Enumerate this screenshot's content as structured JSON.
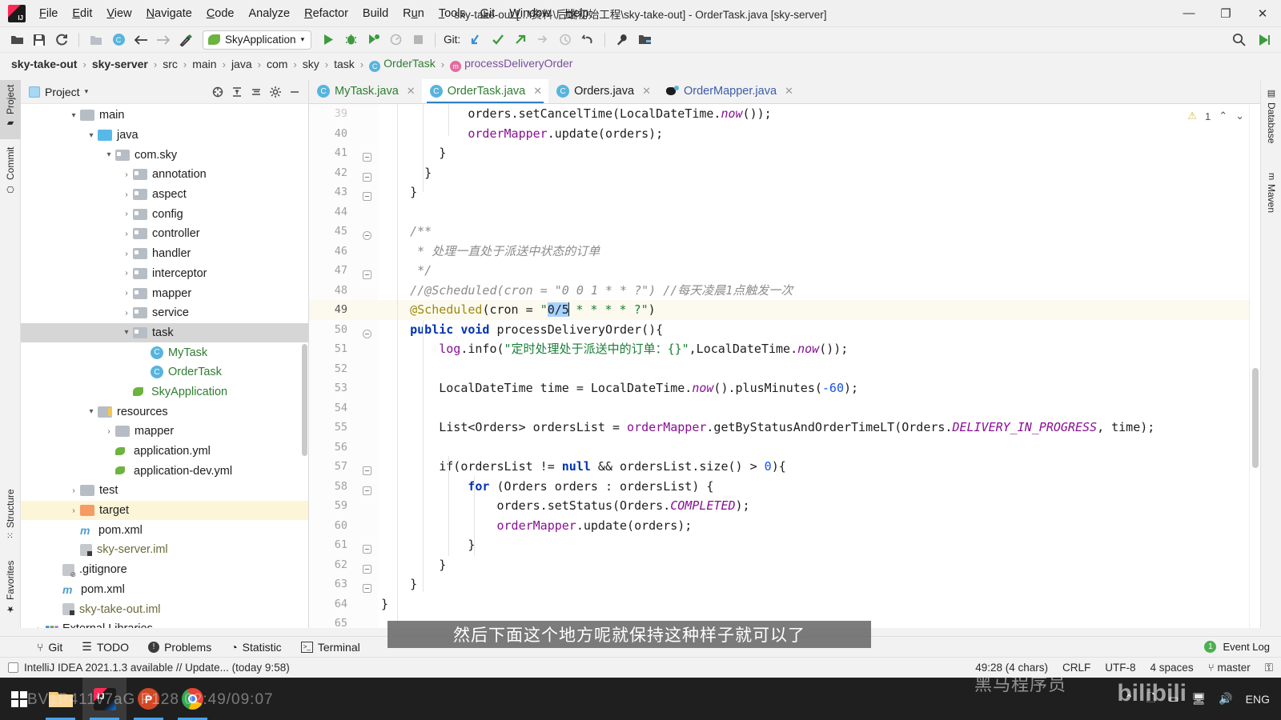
{
  "window": {
    "title": "sky-take-out [...\\资料\\后端初始工程\\sky-take-out] - OrderTask.java [sky-server]",
    "minimize": "—",
    "maximize": "❐",
    "close": "✕"
  },
  "menu": [
    {
      "label": "File"
    },
    {
      "label": "Edit"
    },
    {
      "label": "View"
    },
    {
      "label": "Navigate"
    },
    {
      "label": "Code"
    },
    {
      "label": "Analyze"
    },
    {
      "label": "Refactor"
    },
    {
      "label": "Build"
    },
    {
      "label": "Run"
    },
    {
      "label": "Tools"
    },
    {
      "label": "Git"
    },
    {
      "label": "Window"
    },
    {
      "label": "Help"
    }
  ],
  "toolbar": {
    "open_icon": "open-folder-icon",
    "save_icon": "save-icon",
    "sync_icon": "refresh-icon",
    "module_icon": "module-icon",
    "class_icon": "class-icon",
    "back_icon": "back-arrow-icon",
    "forward_icon": "forward-arrow-icon",
    "build_icon": "hammer-icon",
    "run_config": "SkyApplication",
    "run_icon": "run-icon",
    "debug_icon": "debug-icon",
    "run_coverage_icon": "run-with-coverage-icon",
    "profile_icon": "profiler-icon",
    "stop_icon": "stop-icon",
    "git_label": "Git:",
    "search_icon": "search-icon",
    "update_icon": "update-project-icon",
    "commit_icon": "commit-icon",
    "push_icon": "push-icon",
    "rollback_icon": "rollback-icon",
    "history_icon": "history-icon",
    "undo_icon": "undo-icon",
    "settings_icon": "wrench-icon",
    "project_structure_icon": "project-structure-icon"
  },
  "breadcrumb": [
    {
      "label": "sky-take-out",
      "style": "bold"
    },
    {
      "label": "sky-server",
      "style": "bold"
    },
    {
      "label": "src",
      "style": "plain"
    },
    {
      "label": "main",
      "style": "plain"
    },
    {
      "label": "java",
      "style": "plain"
    },
    {
      "label": "com",
      "style": "plain"
    },
    {
      "label": "sky",
      "style": "plain"
    },
    {
      "label": "task",
      "style": "plain"
    },
    {
      "label": "OrderTask",
      "style": "class",
      "badge": "C"
    },
    {
      "label": "processDeliveryOrder",
      "style": "method",
      "badge": "m"
    }
  ],
  "left_rail": [
    {
      "label": "Project",
      "icon": "project-icon",
      "active": true
    },
    {
      "label": "Commit",
      "icon": "commit-icon",
      "active": false
    },
    {
      "label": "Structure",
      "icon": "structure-icon",
      "active": false
    },
    {
      "label": "Favorites",
      "icon": "star-icon",
      "active": false
    }
  ],
  "right_rail": [
    {
      "label": "Database",
      "icon": "database-icon"
    },
    {
      "label": "Maven",
      "icon": "maven-icon"
    }
  ],
  "project_panel": {
    "title": "Project",
    "caret": "▾",
    "actions": [
      "target-icon",
      "collapse-all-icon",
      "expand-selection-icon",
      "gear-icon",
      "hide-icon"
    ],
    "tree": [
      {
        "depth": 2,
        "arrow": "▾",
        "icon": "folder-grey",
        "label": "main",
        "style": "plain"
      },
      {
        "depth": 3,
        "arrow": "▾",
        "icon": "folder-blue",
        "label": "java",
        "style": "plain"
      },
      {
        "depth": 4,
        "arrow": "▾",
        "icon": "package",
        "label": "com.sky",
        "style": "plain"
      },
      {
        "depth": 5,
        "arrow": "›",
        "icon": "package",
        "label": "annotation",
        "style": "plain"
      },
      {
        "depth": 5,
        "arrow": "›",
        "icon": "package",
        "label": "aspect",
        "style": "plain"
      },
      {
        "depth": 5,
        "arrow": "›",
        "icon": "package",
        "label": "config",
        "style": "plain"
      },
      {
        "depth": 5,
        "arrow": "›",
        "icon": "package",
        "label": "controller",
        "style": "plain"
      },
      {
        "depth": 5,
        "arrow": "›",
        "icon": "package",
        "label": "handler",
        "style": "plain"
      },
      {
        "depth": 5,
        "arrow": "›",
        "icon": "package",
        "label": "interceptor",
        "style": "plain"
      },
      {
        "depth": 5,
        "arrow": "›",
        "icon": "package",
        "label": "mapper",
        "style": "plain"
      },
      {
        "depth": 5,
        "arrow": "›",
        "icon": "package",
        "label": "service",
        "style": "plain"
      },
      {
        "depth": 5,
        "arrow": "▾",
        "icon": "package",
        "label": "task",
        "style": "plain",
        "selected": true
      },
      {
        "depth": 6,
        "arrow": "",
        "icon": "class",
        "label": "MyTask",
        "style": "green"
      },
      {
        "depth": 6,
        "arrow": "",
        "icon": "class",
        "label": "OrderTask",
        "style": "green"
      },
      {
        "depth": 5,
        "arrow": "",
        "icon": "spring",
        "label": "SkyApplication",
        "style": "green"
      },
      {
        "depth": 3,
        "arrow": "▾",
        "icon": "folder-resources",
        "label": "resources",
        "style": "plain"
      },
      {
        "depth": 4,
        "arrow": "›",
        "icon": "folder-grey",
        "label": "mapper",
        "style": "plain"
      },
      {
        "depth": 4,
        "arrow": "",
        "icon": "yml",
        "label": "application.yml",
        "style": "plain"
      },
      {
        "depth": 4,
        "arrow": "",
        "icon": "yml",
        "label": "application-dev.yml",
        "style": "plain"
      },
      {
        "depth": 2,
        "arrow": "›",
        "icon": "folder-grey",
        "label": "test",
        "style": "plain"
      },
      {
        "depth": 2,
        "arrow": "›",
        "icon": "folder-orange",
        "label": "target",
        "style": "plain",
        "highlight": true
      },
      {
        "depth": 2,
        "arrow": "",
        "icon": "maven",
        "label": "pom.xml",
        "style": "plain"
      },
      {
        "depth": 2,
        "arrow": "",
        "icon": "iml",
        "label": "sky-server.iml",
        "style": "brown"
      },
      {
        "depth": 1,
        "arrow": "",
        "icon": "gitignore",
        "label": ".gitignore",
        "style": "plain"
      },
      {
        "depth": 1,
        "arrow": "",
        "icon": "maven",
        "label": "pom.xml",
        "style": "plain"
      },
      {
        "depth": 1,
        "arrow": "",
        "icon": "iml",
        "label": "sky-take-out.iml",
        "style": "brown"
      },
      {
        "depth": 0,
        "arrow": "›",
        "icon": "library",
        "label": "External Libraries",
        "style": "plain"
      }
    ]
  },
  "editor": {
    "tabs": [
      {
        "label": "MyTask.java",
        "icon": "java-class-icon",
        "style": "green",
        "active": false
      },
      {
        "label": "OrderTask.java",
        "icon": "java-class-icon",
        "style": "green",
        "active": true
      },
      {
        "label": "Orders.java",
        "icon": "java-class-icon",
        "style": "plain",
        "active": false
      },
      {
        "label": "OrderMapper.java",
        "icon": "mybatis-mapper-icon",
        "style": "blue",
        "active": false
      }
    ],
    "inspection": {
      "warning_count": "1",
      "warning_icon": "warning-triangle-icon",
      "prev_icon": "⌃",
      "next_icon": "⌄"
    },
    "first_visible_line": 39,
    "current_line": 49,
    "lines": [
      {
        "n": 39,
        "text": "            orders.setCancelTime(LocalDateTime.now());",
        "clipped": true
      },
      {
        "n": 40,
        "text": "            orderMapper.update(orders);"
      },
      {
        "n": 41,
        "text": "        }"
      },
      {
        "n": 42,
        "text": "      }"
      },
      {
        "n": 43,
        "text": "    }"
      },
      {
        "n": 44,
        "text": ""
      },
      {
        "n": 45,
        "text": "    /**"
      },
      {
        "n": 46,
        "text": "     * 处理一直处于派送中状态的订单"
      },
      {
        "n": 47,
        "text": "     */"
      },
      {
        "n": 48,
        "text": "    //@Scheduled(cron = \"0 0 1 * * ?\") //每天凌晨1点触发一次"
      },
      {
        "n": 49,
        "text": "    @Scheduled(cron = \"0/5 * * * * ?\")",
        "current": true
      },
      {
        "n": 50,
        "text": "    public void processDeliveryOrder(){"
      },
      {
        "n": 51,
        "text": "        log.info(\"定时处理处于派送中的订单：{}\",LocalDateTime.now());"
      },
      {
        "n": 52,
        "text": ""
      },
      {
        "n": 53,
        "text": "        LocalDateTime time = LocalDateTime.now().plusMinutes(-60);"
      },
      {
        "n": 54,
        "text": ""
      },
      {
        "n": 55,
        "text": "        List<Orders> ordersList = orderMapper.getByStatusAndOrderTimeLT(Orders.DELIVERY_IN_PROGRESS, time);"
      },
      {
        "n": 56,
        "text": ""
      },
      {
        "n": 57,
        "text": "        if(ordersList != null && ordersList.size() > 0){"
      },
      {
        "n": 58,
        "text": "            for (Orders orders : ordersList) {"
      },
      {
        "n": 59,
        "text": "                orders.setStatus(Orders.COMPLETED);"
      },
      {
        "n": 60,
        "text": "                orderMapper.update(orders);"
      },
      {
        "n": 61,
        "text": "            }"
      },
      {
        "n": 62,
        "text": "        }"
      },
      {
        "n": 63,
        "text": "    }"
      },
      {
        "n": 64,
        "text": "}"
      },
      {
        "n": 65,
        "text": ""
      }
    ],
    "selection_text": "0/5"
  },
  "bottom_tools": [
    {
      "label": "Git",
      "icon": "git-branch-icon"
    },
    {
      "label": "TODO",
      "icon": "todo-icon"
    },
    {
      "label": "Problems",
      "icon": "problems-icon"
    },
    {
      "label": "Statistic",
      "icon": "statistic-icon"
    },
    {
      "label": "Terminal",
      "icon": "terminal-icon"
    }
  ],
  "bottom_right": {
    "event_log": "Event Log",
    "event_badge": "1"
  },
  "status_bar": {
    "message": "IntelliJ IDEA 2021.1.3 available // Update...  (today 9:58)",
    "position": "49:28 (4 chars)",
    "line_sep": "CRLF",
    "encoding": "UTF-8",
    "indent": "4 spaces",
    "branch": "master",
    "branch_icon": "git-branch-icon",
    "lock_icon": "unlock-icon"
  },
  "subtitle": "然后下面这个地方呢就保持这种样子就可以了",
  "taskbar": {
    "start_icon": "windows-start-icon",
    "apps": [
      {
        "name": "file-explorer-icon"
      },
      {
        "name": "intellij-idea-icon",
        "active": true
      },
      {
        "name": "powerpoint-icon"
      },
      {
        "name": "chrome-icon"
      }
    ],
    "tray": [
      "chevron-up-icon",
      "onedrive-icon",
      "battery-icon",
      "network-icon",
      "volume-icon"
    ],
    "language": "ENG"
  },
  "watermarks": {
    "video_info": "BV1P411v7aG P128 02:49/09:07",
    "bilibili_logo": "bilibili",
    "channel": "黑马程序员"
  }
}
